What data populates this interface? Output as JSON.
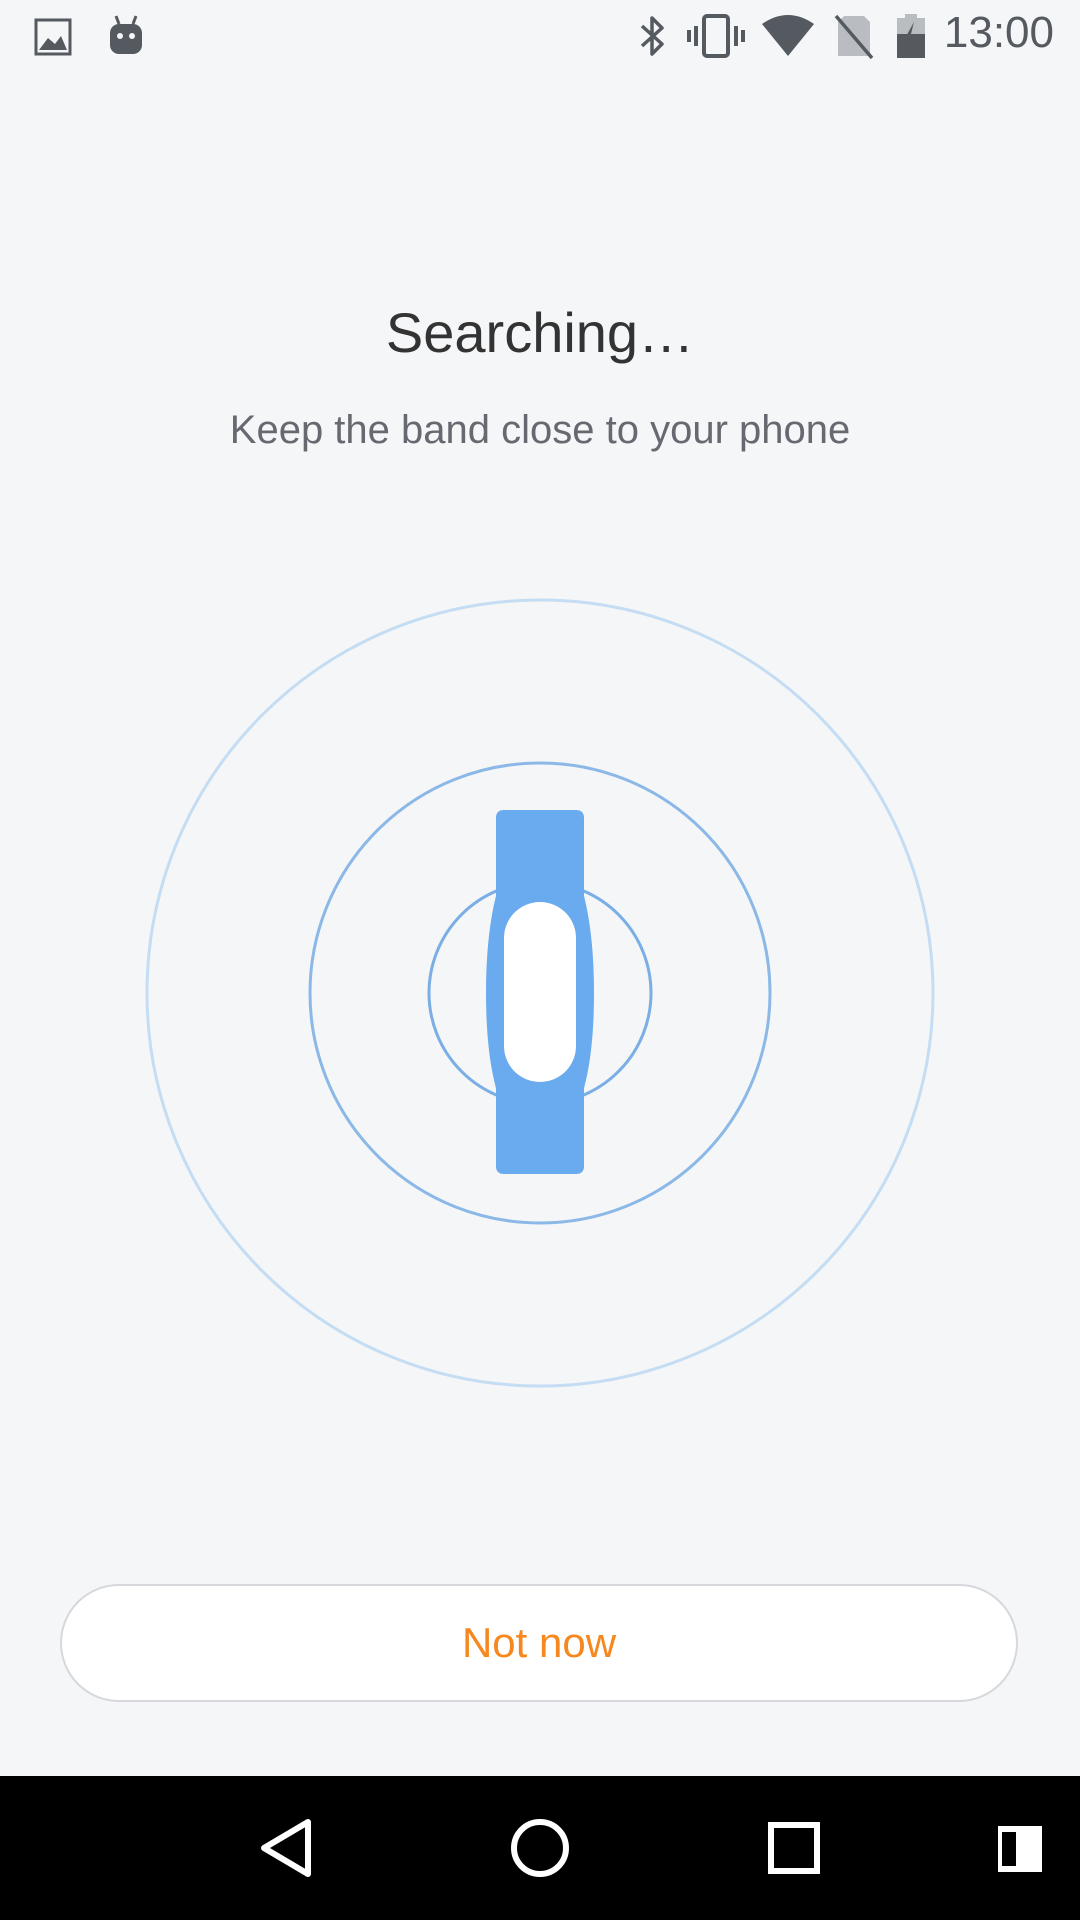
{
  "status_bar": {
    "time": "13:00",
    "icons": [
      "gallery-icon",
      "android-icon",
      "bluetooth-icon",
      "vibrate-icon",
      "wifi-icon",
      "no-sim-icon",
      "battery-charging-icon"
    ]
  },
  "main": {
    "title": "Searching…",
    "subtitle": "Keep the band close to your phone"
  },
  "radar": {
    "band_color": "#6aaaee",
    "ring_inner_color": "#8bb8e6",
    "ring_outer_color": "#c5ddf3"
  },
  "actions": {
    "not_now_label": "Not now",
    "accent_color": "#f5881f"
  },
  "nav_bar": {
    "buttons": [
      "back-icon",
      "home-icon",
      "recents-icon",
      "split-screen-icon"
    ]
  }
}
